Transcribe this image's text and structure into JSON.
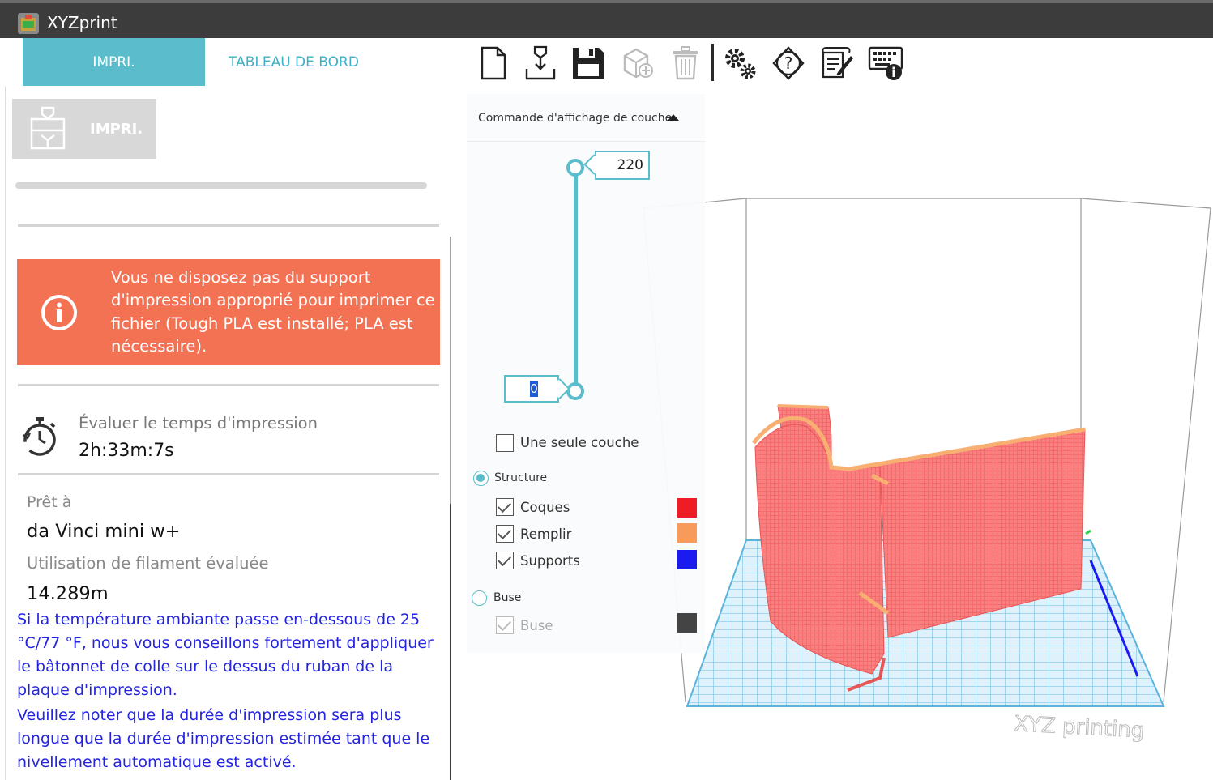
{
  "window": {
    "title": "XYZprint"
  },
  "nav": {
    "tab_print": "IMPRI.",
    "tab_dashboard": "TABLEAU DE BORD"
  },
  "toolbar": {
    "icons": [
      "new-file-icon",
      "import-icon",
      "save-icon",
      "add-object-icon",
      "delete-icon",
      "settings-icon",
      "help-icon",
      "notes-icon",
      "keyboard-info-icon"
    ]
  },
  "left": {
    "print_button": "IMPRI.",
    "alert": "Vous ne disposez pas du support d'impression approprié pour imprimer ce fichier (Tough PLA est installé; PLA est nécessaire).",
    "estimate_label": "Évaluer le temps d'impression",
    "estimate_value": "2h:33m:7s",
    "ready_label": "Prêt à",
    "ready_value": "da Vinci mini w+",
    "filament_label": "Utilisation de filament évaluée",
    "filament_value": "14.289m",
    "note1": "Si la température ambiante passe en-dessous de 25 °C/77 °F, nous vous conseillons fortement d'appliquer le bâtonnet de colle sur le dessus du ruban de la plaque d'impression.",
    "note2": "Veuillez noter que la durée d'impression sera plus longue que la durée d'impression estimée tant que le nivellement automatique est activé."
  },
  "layer_panel": {
    "title": "Commande d'affichage de couche",
    "top_value": "220",
    "bottom_value": "0",
    "single_layer": "Une seule couche",
    "structure": "Structure",
    "shells": "Coques",
    "fill": "Remplir",
    "supports": "Supports",
    "nozzle_group": "Buse",
    "nozzle": "Buse",
    "colors": {
      "shells": "#ee1c24",
      "fill": "#f79b5c",
      "supports": "#1b1bf0",
      "nozzle": "#444444"
    }
  },
  "viewport": {
    "watermark": "XYZ printing"
  }
}
